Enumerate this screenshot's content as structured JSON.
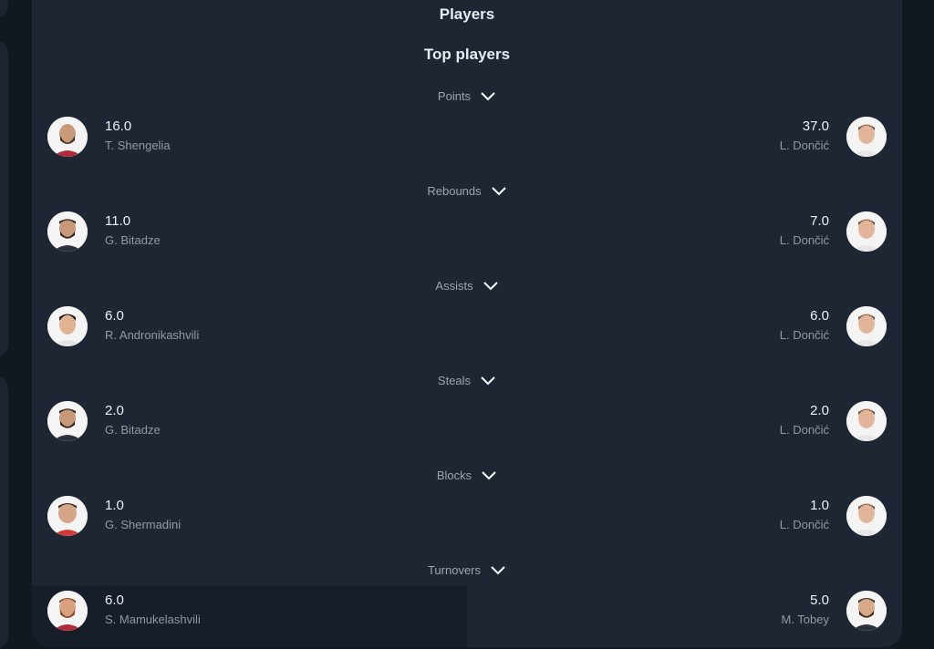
{
  "panel": {
    "title": "Players",
    "section_title": "Top players"
  },
  "stats": [
    {
      "label": "Points",
      "left": {
        "value": "16.0",
        "name": "T. Shengelia"
      },
      "right": {
        "value": "37.0",
        "name": "L. Dončić"
      }
    },
    {
      "label": "Rebounds",
      "left": {
        "value": "11.0",
        "name": "G. Bitadze"
      },
      "right": {
        "value": "7.0",
        "name": "L. Dončić"
      }
    },
    {
      "label": "Assists",
      "left": {
        "value": "6.0",
        "name": "R. Andronikashvili"
      },
      "right": {
        "value": "6.0",
        "name": "L. Dončić"
      }
    },
    {
      "label": "Steals",
      "left": {
        "value": "2.0",
        "name": "G. Bitadze"
      },
      "right": {
        "value": "2.0",
        "name": "L. Dončić"
      }
    },
    {
      "label": "Blocks",
      "left": {
        "value": "1.0",
        "name": "G. Shermadini"
      },
      "right": {
        "value": "1.0",
        "name": "L. Dončić"
      }
    },
    {
      "label": "Turnovers",
      "left": {
        "value": "6.0",
        "name": "S. Mamukelashvili"
      },
      "right": {
        "value": "5.0",
        "name": "M. Tobey"
      }
    }
  ],
  "icons": {
    "dropdown": "chevron-down-icon",
    "avatar": "player-avatar"
  },
  "colors": {
    "page_background": "#111820",
    "panel_background": "#1e2633",
    "primary_text": "#eef1f5",
    "secondary_text": "#8f9aa8",
    "label_text": "#9aa5b4"
  }
}
